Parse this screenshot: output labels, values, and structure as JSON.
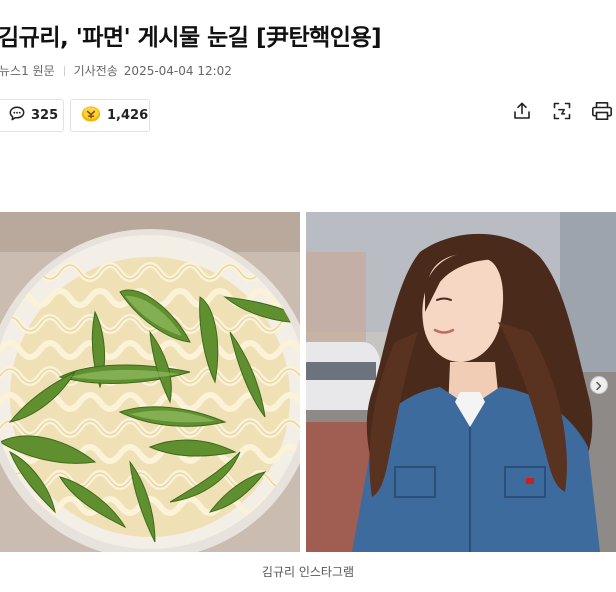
{
  "article": {
    "title": "김규리, '파면' 게시물 눈길 [尹탄핵인용]",
    "source": "뉴스1 원문",
    "sent_label": "기사전송",
    "datetime": "2025-04-04 12:02"
  },
  "reactions": {
    "comments": {
      "icon": "comment-bubble-icon",
      "count": "325"
    },
    "likes": {
      "icon": "like-badge-icon",
      "count": "1,426",
      "color": "#f2b705"
    }
  },
  "toolbar": {
    "share_icon": "share-upload-icon",
    "capture_icon": "screen-capture-icon",
    "print_icon": "printer-icon"
  },
  "photo": {
    "caption": "김규리 인스타그램",
    "left_panel": "noodle-bowl-image",
    "right_panel": "woman-portrait-image",
    "next_icon": "chevron-right-icon"
  },
  "colors": {
    "text": "#111111",
    "meta": "#666666",
    "border": "#e2e2e2",
    "like_badge": "#f2b705"
  }
}
